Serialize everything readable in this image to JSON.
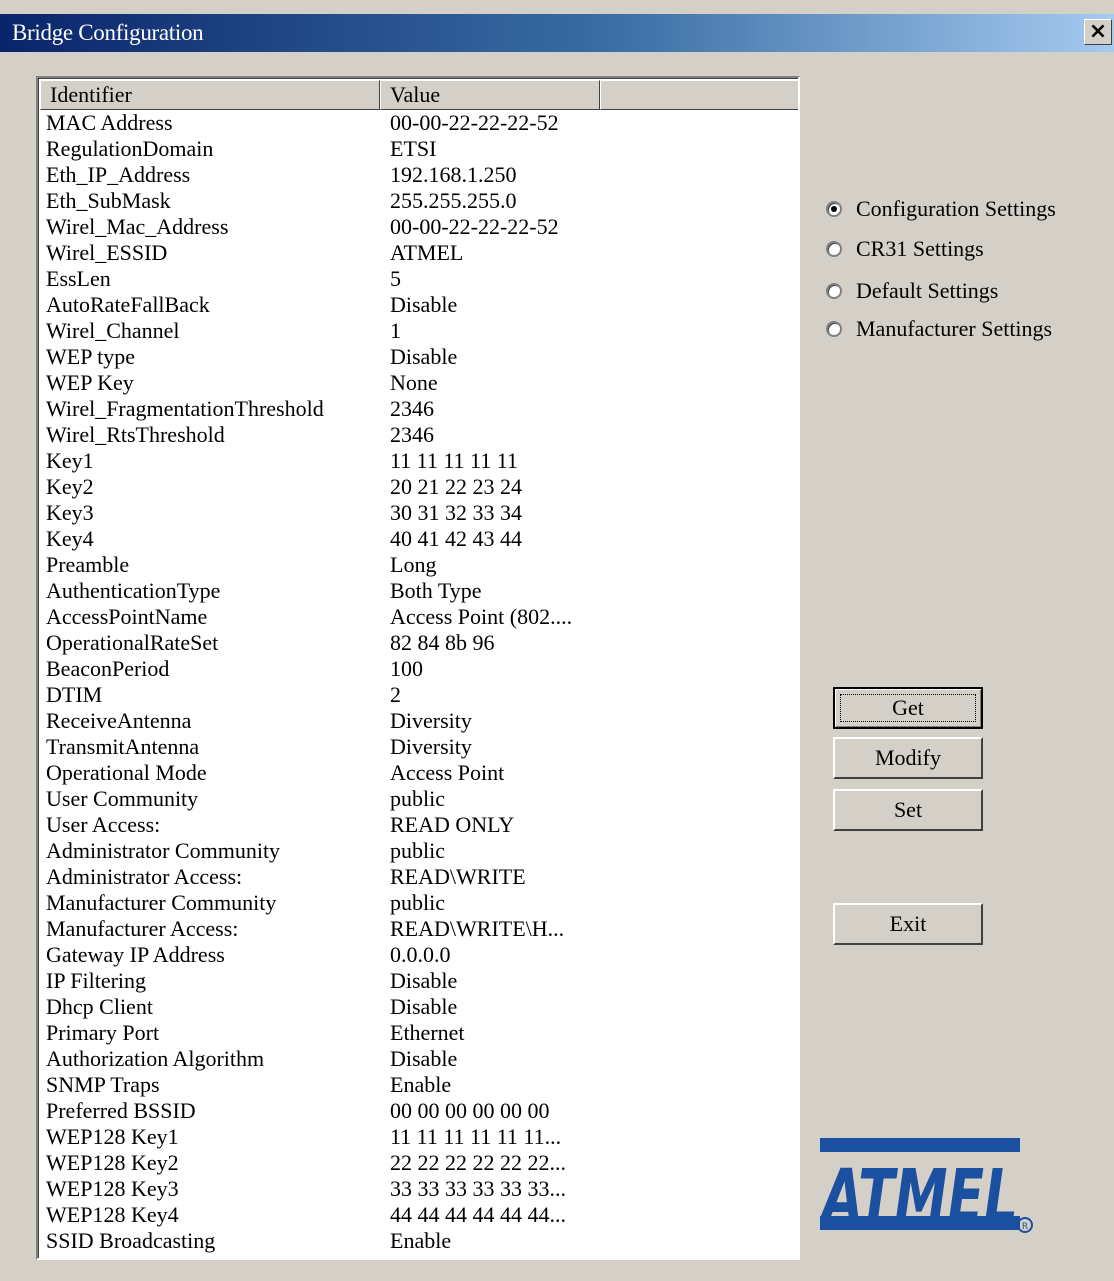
{
  "window": {
    "title": "Bridge Configuration",
    "close_label": "×"
  },
  "list": {
    "columns": [
      "Identifier",
      "Value"
    ],
    "rows": [
      {
        "id": "MAC Address",
        "value": "00-00-22-22-22-52"
      },
      {
        "id": "RegulationDomain",
        "value": "ETSI"
      },
      {
        "id": "Eth_IP_Address",
        "value": "192.168.1.250"
      },
      {
        "id": "Eth_SubMask",
        "value": "255.255.255.0"
      },
      {
        "id": "Wirel_Mac_Address",
        "value": "00-00-22-22-22-52"
      },
      {
        "id": "Wirel_ESSID",
        "value": "ATMEL"
      },
      {
        "id": "EssLen",
        "value": "5"
      },
      {
        "id": "AutoRateFallBack",
        "value": "Disable"
      },
      {
        "id": "Wirel_Channel",
        "value": "1"
      },
      {
        "id": "WEP type",
        "value": "Disable"
      },
      {
        "id": "WEP Key",
        "value": "None"
      },
      {
        "id": "Wirel_FragmentationThreshold",
        "value": "2346"
      },
      {
        "id": "Wirel_RtsThreshold",
        "value": "2346"
      },
      {
        "id": "Key1",
        "value": "11 11 11 11 11"
      },
      {
        "id": "Key2",
        "value": "20 21 22 23 24"
      },
      {
        "id": "Key3",
        "value": "30 31 32 33 34"
      },
      {
        "id": "Key4",
        "value": "40 41 42 43 44"
      },
      {
        "id": "Preamble",
        "value": "Long"
      },
      {
        "id": "AuthenticationType",
        "value": "Both Type"
      },
      {
        "id": "AccessPointName",
        "value": "Access Point (802...."
      },
      {
        "id": "OperationalRateSet",
        "value": "82 84 8b 96"
      },
      {
        "id": "BeaconPeriod",
        "value": "100"
      },
      {
        "id": "DTIM",
        "value": "2"
      },
      {
        "id": "ReceiveAntenna",
        "value": "Diversity"
      },
      {
        "id": "TransmitAntenna",
        "value": "Diversity"
      },
      {
        "id": "Operational Mode",
        "value": "Access Point"
      },
      {
        "id": "User Community",
        "value": "public"
      },
      {
        "id": "User Access:",
        "value": "READ ONLY"
      },
      {
        "id": "Administrator Community",
        "value": "public"
      },
      {
        "id": "Administrator Access:",
        "value": "READ\\WRITE"
      },
      {
        "id": "Manufacturer Community",
        "value": "public"
      },
      {
        "id": "Manufacturer Access:",
        "value": "READ\\WRITE\\H..."
      },
      {
        "id": "Gateway IP Address",
        "value": "0.0.0.0"
      },
      {
        "id": "IP Filtering",
        "value": "Disable"
      },
      {
        "id": "Dhcp Client",
        "value": "Disable"
      },
      {
        "id": "Primary Port",
        "value": "Ethernet"
      },
      {
        "id": "Authorization Algorithm",
        "value": "Disable"
      },
      {
        "id": "SNMP Traps",
        "value": "Enable"
      },
      {
        "id": "Preferred BSSID",
        "value": "00 00 00 00 00 00"
      },
      {
        "id": "WEP128 Key1",
        "value": "11 11 11 11 11 11..."
      },
      {
        "id": "WEP128 Key2",
        "value": "22 22 22 22 22 22..."
      },
      {
        "id": "WEP128 Key3",
        "value": "33 33 33 33 33 33..."
      },
      {
        "id": "WEP128 Key4",
        "value": "44 44 44 44 44 44..."
      },
      {
        "id": "SSID Broadcasting",
        "value": "Enable"
      }
    ]
  },
  "settings_radio": {
    "options": [
      {
        "label": "Configuration Settings",
        "checked": true
      },
      {
        "label": "CR31 Settings",
        "checked": false
      },
      {
        "label": "Default Settings",
        "checked": false
      },
      {
        "label": "Manufacturer Settings",
        "checked": false
      }
    ]
  },
  "buttons": {
    "get": "Get",
    "modify": "Modify",
    "set": "Set",
    "exit": "Exit"
  },
  "logo": {
    "text": "ATMEL",
    "color": "#1b4fa0"
  }
}
